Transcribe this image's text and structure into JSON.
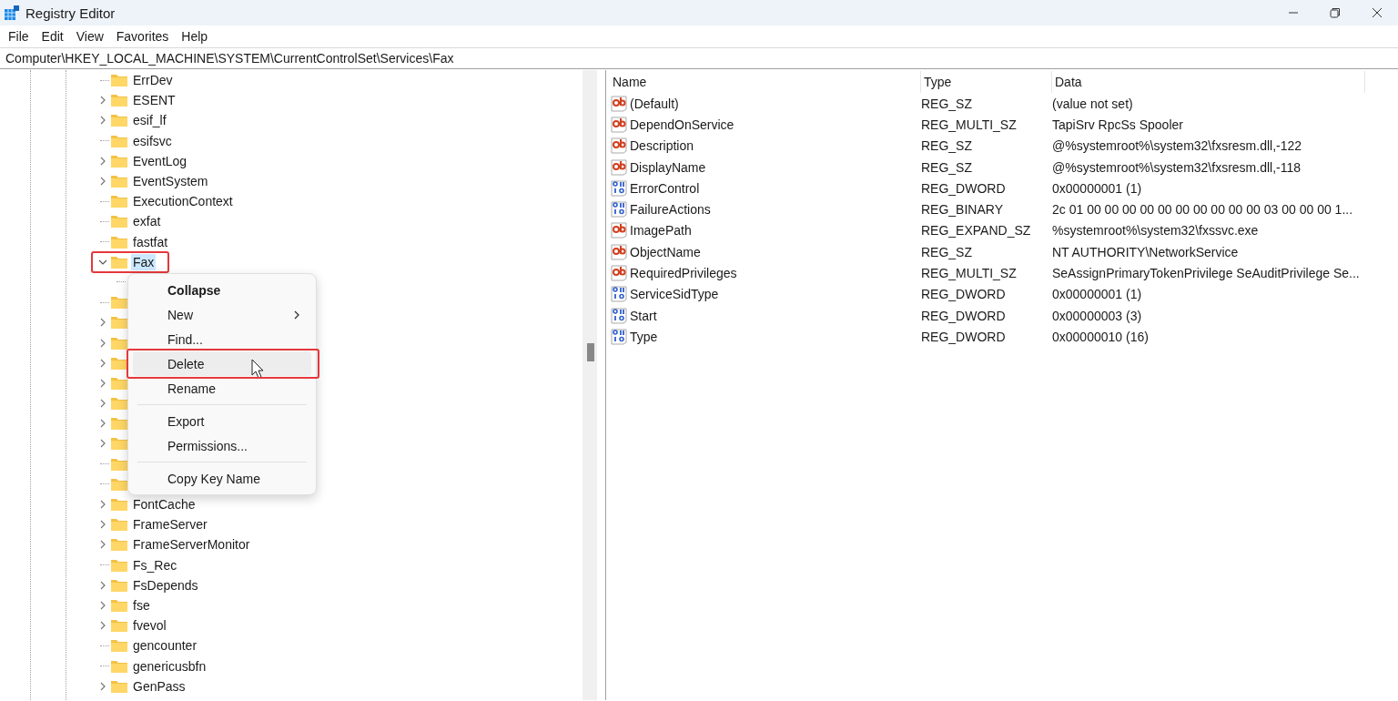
{
  "window": {
    "title": "Registry Editor"
  },
  "menu_bar": [
    "File",
    "Edit",
    "View",
    "Favorites",
    "Help"
  ],
  "address": "Computer\\HKEY_LOCAL_MACHINE\\SYSTEM\\CurrentControlSet\\Services\\Fax",
  "tree": {
    "items": [
      {
        "kind": "leaf",
        "name": "ErrDev",
        "selected": false
      },
      {
        "kind": "node",
        "name": "ESENT",
        "expanded": false,
        "selected": false
      },
      {
        "kind": "node",
        "name": "esif_lf",
        "expanded": false,
        "selected": false
      },
      {
        "kind": "leaf",
        "name": "esifsvc",
        "selected": false
      },
      {
        "kind": "node",
        "name": "EventLog",
        "expanded": false,
        "selected": false
      },
      {
        "kind": "node",
        "name": "EventSystem",
        "expanded": false,
        "selected": false
      },
      {
        "kind": "leaf",
        "name": "ExecutionContext",
        "selected": false
      },
      {
        "kind": "leaf",
        "name": "exfat",
        "selected": false
      },
      {
        "kind": "leaf",
        "name": "fastfat",
        "selected": false
      },
      {
        "kind": "node",
        "name": "Fax",
        "expanded": true,
        "selected": true,
        "annotated": true,
        "children": [
          {
            "kind": "leaf"
          }
        ]
      },
      {
        "kind": "leaf",
        "selected": false
      },
      {
        "kind": "node",
        "expanded": false,
        "selected": false
      },
      {
        "kind": "node",
        "expanded": false,
        "selected": false
      },
      {
        "kind": "node",
        "expanded": false,
        "selected": false
      },
      {
        "kind": "node",
        "expanded": false,
        "selected": false
      },
      {
        "kind": "node",
        "expanded": false,
        "selected": false
      },
      {
        "kind": "node",
        "expanded": false,
        "selected": false
      },
      {
        "kind": "node",
        "expanded": false,
        "selected": false
      },
      {
        "kind": "leaf",
        "selected": false
      },
      {
        "kind": "leaf",
        "selected": false
      },
      {
        "kind": "node",
        "name": "FontCache",
        "expanded": false,
        "selected": false
      },
      {
        "kind": "node",
        "name": "FrameServer",
        "expanded": false,
        "selected": false
      },
      {
        "kind": "node",
        "name": "FrameServerMonitor",
        "expanded": false,
        "selected": false
      },
      {
        "kind": "leaf",
        "name": "Fs_Rec",
        "selected": false
      },
      {
        "kind": "node",
        "name": "FsDepends",
        "expanded": false,
        "selected": false
      },
      {
        "kind": "node",
        "name": "fse",
        "expanded": false,
        "selected": false
      },
      {
        "kind": "node",
        "name": "fvevol",
        "expanded": false,
        "selected": false
      },
      {
        "kind": "leaf",
        "name": "gencounter",
        "selected": false
      },
      {
        "kind": "leaf",
        "name": "genericusbfn",
        "selected": false
      },
      {
        "kind": "node",
        "name": "GenPass",
        "expanded": false,
        "selected": false
      }
    ]
  },
  "context_menu": {
    "items": [
      {
        "kind": "item",
        "label": "Collapse",
        "default": true,
        "hovered": false
      },
      {
        "kind": "item",
        "label": "New",
        "submenu": true,
        "hovered": false
      },
      {
        "kind": "item",
        "label": "Find...",
        "hovered": false
      },
      {
        "kind": "item",
        "label": "Delete",
        "hovered": true,
        "annotated": true
      },
      {
        "kind": "item",
        "label": "Rename",
        "hovered": false
      },
      {
        "kind": "separator"
      },
      {
        "kind": "item",
        "label": "Export",
        "hovered": false
      },
      {
        "kind": "item",
        "label": "Permissions...",
        "hovered": false
      },
      {
        "kind": "separator"
      },
      {
        "kind": "item",
        "label": "Copy Key Name",
        "hovered": false
      }
    ]
  },
  "values": {
    "columns": [
      "Name",
      "Type",
      "Data"
    ],
    "rows": [
      {
        "kind": "string",
        "name": "(Default)",
        "type": "REG_SZ",
        "data": "(value not set)"
      },
      {
        "kind": "string",
        "name": "DependOnService",
        "type": "REG_MULTI_SZ",
        "data": "TapiSrv RpcSs Spooler"
      },
      {
        "kind": "string",
        "name": "Description",
        "type": "REG_SZ",
        "data": "@%systemroot%\\system32\\fxsresm.dll,-122"
      },
      {
        "kind": "string",
        "name": "DisplayName",
        "type": "REG_SZ",
        "data": "@%systemroot%\\system32\\fxsresm.dll,-118"
      },
      {
        "kind": "binary",
        "name": "ErrorControl",
        "type": "REG_DWORD",
        "data": "0x00000001 (1)"
      },
      {
        "kind": "binary",
        "name": "FailureActions",
        "type": "REG_BINARY",
        "data": "2c 01 00 00 00 00 00 00 00 00 00 00 03 00 00 00 1..."
      },
      {
        "kind": "string",
        "name": "ImagePath",
        "type": "REG_EXPAND_SZ",
        "data": "%systemroot%\\system32\\fxssvc.exe"
      },
      {
        "kind": "string",
        "name": "ObjectName",
        "type": "REG_SZ",
        "data": "NT AUTHORITY\\NetworkService"
      },
      {
        "kind": "string",
        "name": "RequiredPrivileges",
        "type": "REG_MULTI_SZ",
        "data": "SeAssignPrimaryTokenPrivilege SeAuditPrivilege Se..."
      },
      {
        "kind": "binary",
        "name": "ServiceSidType",
        "type": "REG_DWORD",
        "data": "0x00000001 (1)"
      },
      {
        "kind": "binary",
        "name": "Start",
        "type": "REG_DWORD",
        "data": "0x00000003 (3)"
      },
      {
        "kind": "binary",
        "name": "Type",
        "type": "REG_DWORD",
        "data": "0x00000010 (16)"
      }
    ]
  }
}
